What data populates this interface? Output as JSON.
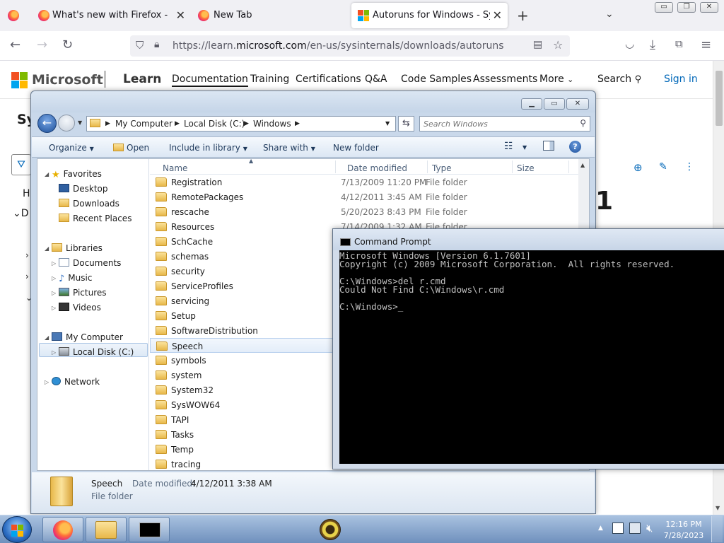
{
  "browser": {
    "tabs": [
      {
        "label": "What's new with Firefox - More",
        "active": false
      },
      {
        "label": "New Tab",
        "active": false
      },
      {
        "label": "Autoruns for Windows - Sysinte",
        "active": true
      }
    ],
    "url_prefix": "https://learn.",
    "url_domain": "microsoft.com",
    "url_path": "/en-us/sysinternals/downloads/autoruns",
    "window_controls": {
      "minimize": "▭",
      "restore": "❐",
      "close": "✕"
    }
  },
  "learn": {
    "brand": "Microsoft",
    "product": "Learn",
    "nav": [
      "Documentation",
      "Training",
      "Certifications",
      "Q&A",
      "Code Samples",
      "Assessments",
      "More"
    ],
    "search_label": "Search",
    "sign_in": "Sign in",
    "partial_title": "Sy",
    "partial_heading": "1",
    "side_letters": [
      "H",
      "D"
    ],
    "colors": {
      "accent": "#0067b8",
      "ms_red": "#f25022",
      "ms_green": "#7fba00",
      "ms_blue": "#00a4ef",
      "ms_yellow": "#ffb900"
    }
  },
  "explorer": {
    "breadcrumbs": [
      "My Computer",
      "Local Disk (C:)",
      "Windows"
    ],
    "search_placeholder": "Search Windows",
    "commands": [
      "Organize",
      "Open",
      "Include in library",
      "Share with",
      "New folder"
    ],
    "nav": {
      "favorites": "Favorites",
      "favorite_items": [
        "Desktop",
        "Downloads",
        "Recent Places"
      ],
      "libraries": "Libraries",
      "library_items": [
        "Documents",
        "Music",
        "Pictures",
        "Videos"
      ],
      "computer": "My Computer",
      "computer_items": [
        "Local Disk (C:)"
      ],
      "network": "Network"
    },
    "columns": [
      "Name",
      "Date modified",
      "Type",
      "Size"
    ],
    "rows": [
      {
        "name": "Registration",
        "date": "7/13/2009 11:20 PM",
        "type": "File folder"
      },
      {
        "name": "RemotePackages",
        "date": "4/12/2011 3:45 AM",
        "type": "File folder"
      },
      {
        "name": "rescache",
        "date": "5/20/2023 8:43 PM",
        "type": "File folder"
      },
      {
        "name": "Resources",
        "date": "7/14/2009 1:32 AM",
        "type": "File folder"
      },
      {
        "name": "SchCache",
        "date": "",
        "type": ""
      },
      {
        "name": "schemas",
        "date": "",
        "type": ""
      },
      {
        "name": "security",
        "date": "",
        "type": ""
      },
      {
        "name": "ServiceProfiles",
        "date": "",
        "type": ""
      },
      {
        "name": "servicing",
        "date": "",
        "type": ""
      },
      {
        "name": "Setup",
        "date": "",
        "type": ""
      },
      {
        "name": "SoftwareDistribution",
        "date": "",
        "type": ""
      },
      {
        "name": "Speech",
        "date": "",
        "type": "",
        "selected": true
      },
      {
        "name": "symbols",
        "date": "",
        "type": ""
      },
      {
        "name": "system",
        "date": "",
        "type": ""
      },
      {
        "name": "System32",
        "date": "",
        "type": ""
      },
      {
        "name": "SysWOW64",
        "date": "",
        "type": ""
      },
      {
        "name": "TAPI",
        "date": "",
        "type": ""
      },
      {
        "name": "Tasks",
        "date": "",
        "type": ""
      },
      {
        "name": "Temp",
        "date": "",
        "type": ""
      },
      {
        "name": "tracing",
        "date": "",
        "type": ""
      }
    ],
    "details": {
      "name": "Speech",
      "date_label": "Date modified:",
      "date": "4/12/2011 3:38 AM",
      "type": "File folder"
    }
  },
  "cmd": {
    "title": "Command Prompt",
    "lines": [
      "Microsoft Windows [Version 6.1.7601]",
      "Copyright (c) 2009 Microsoft Corporation.  All rights reserved.",
      "",
      "C:\\Windows>del r.cmd",
      "Could Not Find C:\\Windows\\r.cmd",
      "",
      "C:\\Windows>_"
    ]
  },
  "taskbar": {
    "time": "12:16 PM",
    "date": "7/28/2023"
  }
}
